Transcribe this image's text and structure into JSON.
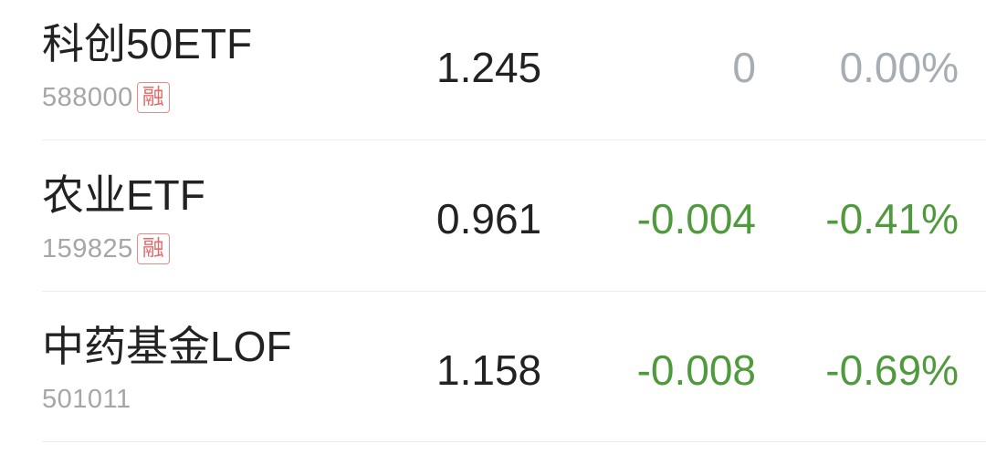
{
  "colors": {
    "flat": "#a6adb4",
    "down": "#4f9a3c",
    "badge": "#e06c6c"
  },
  "rows": [
    {
      "name": "科创50ETF",
      "code": "588000",
      "badge": "融",
      "price": "1.245",
      "change": "0",
      "pct": "0.00%",
      "trend": "flat"
    },
    {
      "name": "农业ETF",
      "code": "159825",
      "badge": "融",
      "price": "0.961",
      "change": "-0.004",
      "pct": "-0.41%",
      "trend": "down"
    },
    {
      "name": "中药基金LOF",
      "code": "501011",
      "price": "1.158",
      "change": "-0.008",
      "pct": "-0.69%",
      "trend": "down"
    }
  ]
}
